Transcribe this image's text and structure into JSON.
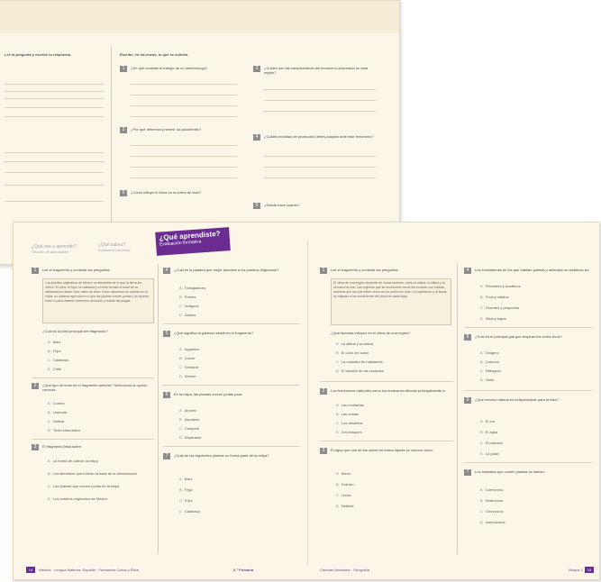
{
  "back_spread": {
    "left_heading": "Lee la pregunta y escribe tu respuesta.",
    "right_heading": "Escribe, en las líneas, lo que se solicita.",
    "right_questions": [
      {
        "num": "1",
        "text": "¿En qué consiste el trabajo de un meteorólogo?"
      },
      {
        "num": "2",
        "text": "¿Cuáles son las características del fenómeno observado en esta región?"
      },
      {
        "num": "3",
        "text": "¿Por qué debemos prevenir los accidentes?"
      },
      {
        "num": "4",
        "text": "¿Cuáles medidas de protección debes adoptar ante este fenómeno?"
      },
      {
        "num": "5",
        "text": "¿Cómo influye el clima en la forma de vida?"
      },
      {
        "num": "6",
        "text": "¿Desde hace cuánto?"
      }
    ]
  },
  "front_spread": {
    "tabs": {
      "first": [
        "¿Qué vas a aprender?",
        "Sección de actividades"
      ],
      "second": [
        "¿Qué sabes?",
        "Evaluación de inicio"
      ],
      "active_title": "¿Qué aprendiste?",
      "active_subtitle": "Evaluación formativa"
    },
    "left_page": {
      "q1_header": "Lee el fragmento y contesta las preguntas.",
      "passage": "Los pueblos originarios de México se alimentan de lo que la tierra les ofrece. El maíz, el frijol, la calabaza y el chile forman la base de su alimentación desde hace miles de años. Estos alimentos se cultivan en la milpa, un sistema agrícola en el que las plantas crecen juntas y se ayudan entre sí para obtener nutrientes del suelo y resistir las plagas.",
      "q1_question": "¿Cuál es la idea principal del fragmento?",
      "q1_options": [
        [
          "A",
          "Maíz"
        ],
        [
          "B",
          "Frijol"
        ],
        [
          "C",
          "Calabaza"
        ],
        [
          "D",
          "Chile"
        ]
      ],
      "q2": {
        "num": "2",
        "text": "¿Qué tipo de texto es el fragmento anterior? Selecciona la opción correcta.",
        "options": [
          [
            "A",
            "Cuento"
          ],
          [
            "B",
            "Leyenda"
          ],
          [
            "C",
            "Noticia"
          ],
          [
            "D",
            "Texto informativo"
          ]
        ]
      },
      "q3": {
        "num": "3",
        "text": "El fragmento trata sobre:",
        "options": [
          [
            "A",
            "La forma de cultivar la milpa"
          ],
          [
            "B",
            "Los alimentos que forman la base de la alimentación"
          ],
          [
            "C",
            "Las plantas que crecen juntas en la milpa"
          ],
          [
            "D",
            "Los pueblos originarios de México"
          ]
        ]
      },
      "q4": {
        "num": "4",
        "text": "¿Cuál es la palabra que mejor describe a los pueblos originarios?",
        "options": [
          [
            "A",
            "Trabajadores"
          ],
          [
            "B",
            "Pobres"
          ],
          [
            "C",
            "Antiguos"
          ],
          [
            "D",
            "Sabios"
          ]
        ]
      },
      "q5": {
        "num": "5",
        "text": "¿Qué significa la palabra resistir en el fragmento?",
        "options": [
          [
            "A",
            "Aguantar"
          ],
          [
            "B",
            "Crecer"
          ],
          [
            "C",
            "Sembrar"
          ],
          [
            "D",
            "Vencer"
          ]
        ]
      },
      "q6": {
        "num": "6",
        "text": "En la milpa, las plantas crecen juntas para:",
        "options": [
          [
            "A",
            "Ahorrar"
          ],
          [
            "B",
            "Ayudarse"
          ],
          [
            "C",
            "Competir"
          ],
          [
            "D",
            "Separarse"
          ]
        ]
      },
      "q7": {
        "num": "7",
        "text": "¿Cuál de las siguientes plantas no forma parte de la milpa?",
        "options": [
          [
            "A",
            "Maíz"
          ],
          [
            "B",
            "Trigo"
          ],
          [
            "C",
            "Frijol"
          ],
          [
            "D",
            "Calabaza"
          ]
        ]
      },
      "footer_left": "Historia · Lengua Materna. Español · Formación Cívica y Ética",
      "footer_right": "6.° Primaria",
      "page_num": "14"
    },
    "right_page": {
      "q1_header": "Lee el fragmento y contesta las preguntas.",
      "passage": "El clima de una región depende de varios factores, como la altitud, la latitud y la cercanía al mar. Las regiones que se encuentran cerca del ecuador son cálidas, mientras que las que están cerca de los polos son frías. La vegetación y la fauna se adaptan a las condiciones del clima de cada lugar.",
      "q1_question": "¿Qué factores influyen en el clima de una región?",
      "q1_options": [
        [
          "A",
          "La altitud y la latitud"
        ],
        [
          "B",
          "El color del suelo"
        ],
        [
          "C",
          "La cantidad de habitantes"
        ],
        [
          "D",
          "El tamaño de las ciudades"
        ]
      ],
      "q2": {
        "num": "2",
        "text": "Los fenómenos naturales como los huracanes afectan principalmente a:",
        "options": [
          [
            "A",
            "Las montañas"
          ],
          [
            "B",
            "Las costas"
          ],
          [
            "C",
            "Los desiertos"
          ],
          [
            "D",
            "Los bosques"
          ]
        ]
      },
      "q3": {
        "num": "3",
        "text": "El agua que cae de las nubes en forma líquida se conoce como:",
        "options": [
          [
            "A",
            "Nieve"
          ],
          [
            "B",
            "Granizo"
          ],
          [
            "C",
            "Lluvia"
          ],
          [
            "D",
            "Neblina"
          ]
        ]
      },
      "q4": {
        "num": "4",
        "text": "Los ecosistemas en los que habitan plantas y animales se clasifican en:",
        "options": [
          [
            "A",
            "Terrestres y acuáticos"
          ],
          [
            "B",
            "Fríos y cálidos"
          ],
          [
            "C",
            "Grandes y pequeños"
          ],
          [
            "D",
            "Altos y bajos"
          ]
        ]
      },
      "q5": {
        "num": "5",
        "text": "¿Cuál es el principal gas que respiran los seres vivos?",
        "options": [
          [
            "A",
            "Oxígeno"
          ],
          [
            "B",
            "Carbono"
          ],
          [
            "C",
            "Nitrógeno"
          ],
          [
            "D",
            "Helio"
          ]
        ]
      },
      "q6": {
        "num": "6",
        "text": "¿Qué recurso natural es indispensable para la vida?",
        "options": [
          [
            "A",
            "El oro"
          ],
          [
            "B",
            "El agua"
          ],
          [
            "C",
            "El petróleo"
          ],
          [
            "D",
            "La plata"
          ]
        ]
      },
      "q7": {
        "num": "7",
        "text": "Los animales que comen plantas se llaman:",
        "options": [
          [
            "A",
            "Carnívoros"
          ],
          [
            "B",
            "Herbívoros"
          ],
          [
            "C",
            "Omnívoros"
          ],
          [
            "D",
            "Insectívoros"
          ]
        ]
      },
      "footer_left": "Ciencias Naturales · Geografía",
      "footer_right": "Bloque 1",
      "page_num": "15"
    }
  }
}
